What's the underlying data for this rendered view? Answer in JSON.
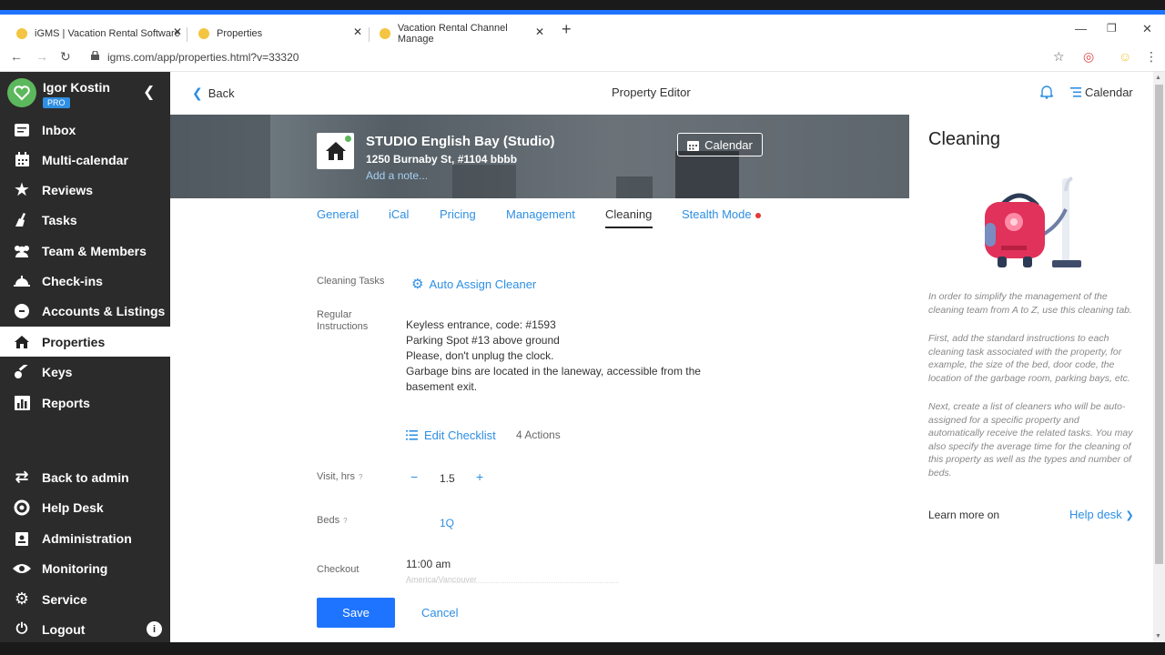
{
  "browser": {
    "tabs": [
      {
        "title": "iGMS | Vacation Rental Software"
      },
      {
        "title": "Properties"
      },
      {
        "title": "Vacation Rental Channel Manage"
      }
    ],
    "url": "igms.com/app/properties.html?v=33320"
  },
  "sidebar": {
    "user_name": "Igor Kostin",
    "badge": "PRO",
    "items": [
      {
        "label": "Inbox",
        "icon": "inbox-icon"
      },
      {
        "label": "Multi-calendar",
        "icon": "calendar-icon"
      },
      {
        "label": "Reviews",
        "icon": "star-icon"
      },
      {
        "label": "Tasks",
        "icon": "broom-icon"
      },
      {
        "label": "Team & Members",
        "icon": "people-icon"
      },
      {
        "label": "Check-ins",
        "icon": "bell-icon"
      },
      {
        "label": "Accounts & Listings",
        "icon": "link-icon"
      },
      {
        "label": "Properties",
        "icon": "home-icon"
      },
      {
        "label": "Keys",
        "icon": "key-icon"
      },
      {
        "label": "Reports",
        "icon": "chart-icon"
      }
    ],
    "bottom_items": [
      {
        "label": "Back to admin",
        "icon": "swap-icon"
      },
      {
        "label": "Help Desk",
        "icon": "lifebuoy-icon"
      },
      {
        "label": "Administration",
        "icon": "id-card-icon"
      },
      {
        "label": "Monitoring",
        "icon": "eye-icon"
      },
      {
        "label": "Service",
        "icon": "gear-icon"
      },
      {
        "label": "Logout",
        "icon": "power-icon"
      }
    ]
  },
  "header": {
    "back": "Back",
    "title": "Property Editor",
    "calendar": "Calendar"
  },
  "property": {
    "name": "STUDIO English Bay (Studio)",
    "address": "1250 Burnaby St, #1104 bbbb",
    "note_link": "Add a note...",
    "calendar_button": "Calendar"
  },
  "tabs": [
    {
      "label": "General"
    },
    {
      "label": "iCal"
    },
    {
      "label": "Pricing"
    },
    {
      "label": "Management"
    },
    {
      "label": "Cleaning"
    },
    {
      "label": "Stealth Mode"
    }
  ],
  "form": {
    "cleaning_tasks_label": "Cleaning Tasks",
    "auto_assign": "Auto Assign Cleaner",
    "regular_label_1": "Regular",
    "regular_label_2": "Instructions",
    "instructions": [
      "Keyless entrance, code: #1593",
      "Parking Spot #13 above ground",
      "Please, don't unplug the clock.",
      "Garbage bins are located in the laneway, accessible from the",
      "basement exit."
    ],
    "edit_checklist": "Edit Checklist",
    "actions_count": "4 Actions",
    "visit_label": "Visit, hrs",
    "visit_value": "1.5",
    "beds_label": "Beds",
    "beds_value": "1Q",
    "checkout_label": "Checkout",
    "checkout_value": "11:00 am",
    "checkout_tz": "America/Vancouver",
    "save": "Save",
    "cancel": "Cancel",
    "help_mark": "?",
    "minus": "−",
    "plus": "+"
  },
  "right_panel": {
    "title": "Cleaning",
    "p1": "In order to simplify the management of the cleaning team from A to Z, use this cleaning tab.",
    "p2": "First, add the standard instructions to each cleaning task associated with the property, for example, the size of the bed, door code, the location of the garbage room, parking bays, etc.",
    "p3": "Next, create a list of cleaners who will be auto-assigned for a specific property and automatically receive the related tasks. You may also specify the average time for the cleaning of this property as well as the types and number of beds.",
    "learn_more": "Learn more on",
    "help_desk": "Help desk"
  },
  "colors": {
    "accent": "#2e8fe3",
    "primary_button": "#1f74ff",
    "sidebar_bg": "#2b2b2b",
    "online_dot": "#5cb85c",
    "alert_dot": "#e53935"
  }
}
